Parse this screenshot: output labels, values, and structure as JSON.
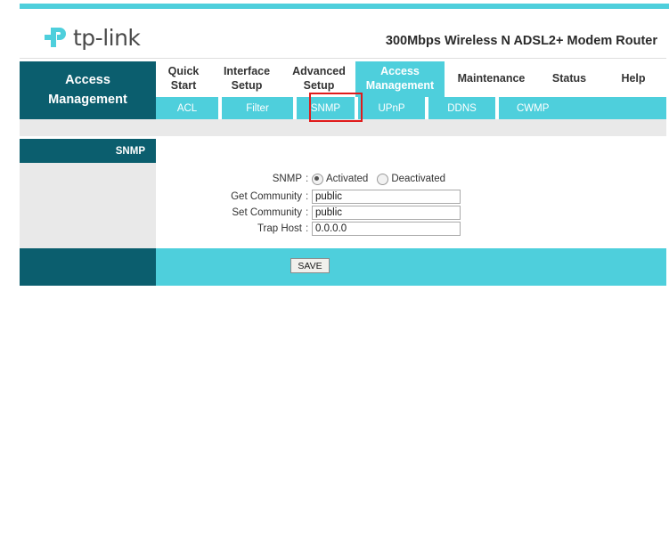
{
  "brand": {
    "logo_icon": "tp-link-logo-icon",
    "logo_text": "tp-link",
    "model": "300Mbps Wireless N ADSL2+ Modem Router"
  },
  "section": {
    "title_line1": "Access",
    "title_line2": "Management"
  },
  "nav": {
    "tabs": [
      {
        "label": "Quick\nStart",
        "active": false
      },
      {
        "label": "Interface\nSetup",
        "active": false
      },
      {
        "label": "Advanced\nSetup",
        "active": false
      },
      {
        "label": "Access\nManagement",
        "active": true
      },
      {
        "label": "Maintenance",
        "active": false
      },
      {
        "label": "Status",
        "active": false
      },
      {
        "label": "Help",
        "active": false
      }
    ]
  },
  "subnav": {
    "tabs": [
      {
        "label": "ACL"
      },
      {
        "label": "Filter"
      },
      {
        "label": "SNMP"
      },
      {
        "label": "UPnP"
      },
      {
        "label": "DDNS"
      },
      {
        "label": "CWMP"
      }
    ],
    "highlighted": "SNMP",
    "highlight_color": "#e01b1b"
  },
  "sidebar": {
    "heading": "SNMP"
  },
  "form": {
    "snmp": {
      "label": "SNMP",
      "options": [
        {
          "label": "Activated",
          "selected": true
        },
        {
          "label": "Deactivated",
          "selected": false
        }
      ]
    },
    "fields": [
      {
        "label": "Get Community",
        "value": "public",
        "placeholder": ""
      },
      {
        "label": "Set Community",
        "value": "public",
        "placeholder": ""
      },
      {
        "label": "Trap Host",
        "value": "0.0.0.0",
        "placeholder": ""
      }
    ],
    "colon": ":"
  },
  "footer": {
    "save_label": "SAVE"
  },
  "colors": {
    "accent_cyan": "#4ecfdc",
    "dark_teal": "#0b5e6e",
    "gray_band": "#e9e9e9",
    "highlight_red": "#e01b1b"
  }
}
